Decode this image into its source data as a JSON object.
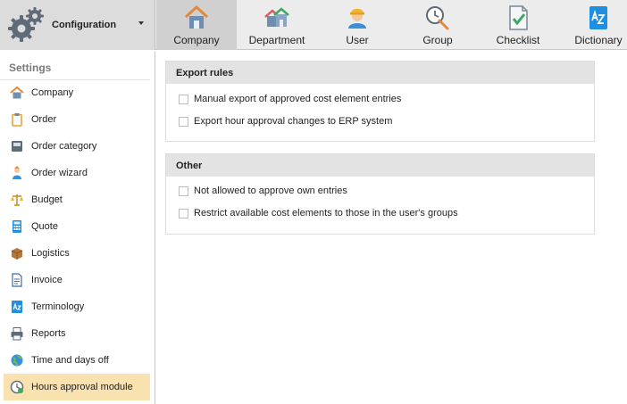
{
  "config": {
    "label": "Configuration"
  },
  "tabs": [
    {
      "label": "Company",
      "icon": "house-icon"
    },
    {
      "label": "Department",
      "icon": "houses-icon"
    },
    {
      "label": "User",
      "icon": "worker-icon"
    },
    {
      "label": "Group",
      "icon": "clock-wrench-icon"
    },
    {
      "label": "Checklist",
      "icon": "checklist-icon"
    },
    {
      "label": "Dictionary",
      "icon": "dictionary-icon"
    }
  ],
  "sidebar": {
    "title": "Settings",
    "items": [
      {
        "label": "Company",
        "icon": "house-icon"
      },
      {
        "label": "Order",
        "icon": "clipboard-icon"
      },
      {
        "label": "Order category",
        "icon": "folder-icon"
      },
      {
        "label": "Order wizard",
        "icon": "wizard-icon"
      },
      {
        "label": "Budget",
        "icon": "scales-icon"
      },
      {
        "label": "Quote",
        "icon": "calculator-icon"
      },
      {
        "label": "Logistics",
        "icon": "box-icon"
      },
      {
        "label": "Invoice",
        "icon": "invoice-icon"
      },
      {
        "label": "Terminology",
        "icon": "dictionary-icon"
      },
      {
        "label": "Reports",
        "icon": "printer-icon"
      },
      {
        "label": "Time and days off",
        "icon": "globe-icon"
      },
      {
        "label": "Hours approval module",
        "icon": "clock-icon"
      }
    ]
  },
  "sections": [
    {
      "title": "Export rules",
      "options": [
        {
          "label": "Manual export of approved cost element entries",
          "checked": false
        },
        {
          "label": "Export hour approval changes to ERP system",
          "checked": false
        }
      ]
    },
    {
      "title": "Other",
      "options": [
        {
          "label": "Not allowed to approve own entries",
          "checked": false
        },
        {
          "label": "Restrict available cost elements to those in the user's groups",
          "checked": false
        }
      ]
    }
  ],
  "colors": {
    "accent_active": "#f9e2b0",
    "header_bg": "#e3e3e3",
    "toolbar_bg": "#ececec",
    "active_tab_bg": "#d0d0d0"
  }
}
